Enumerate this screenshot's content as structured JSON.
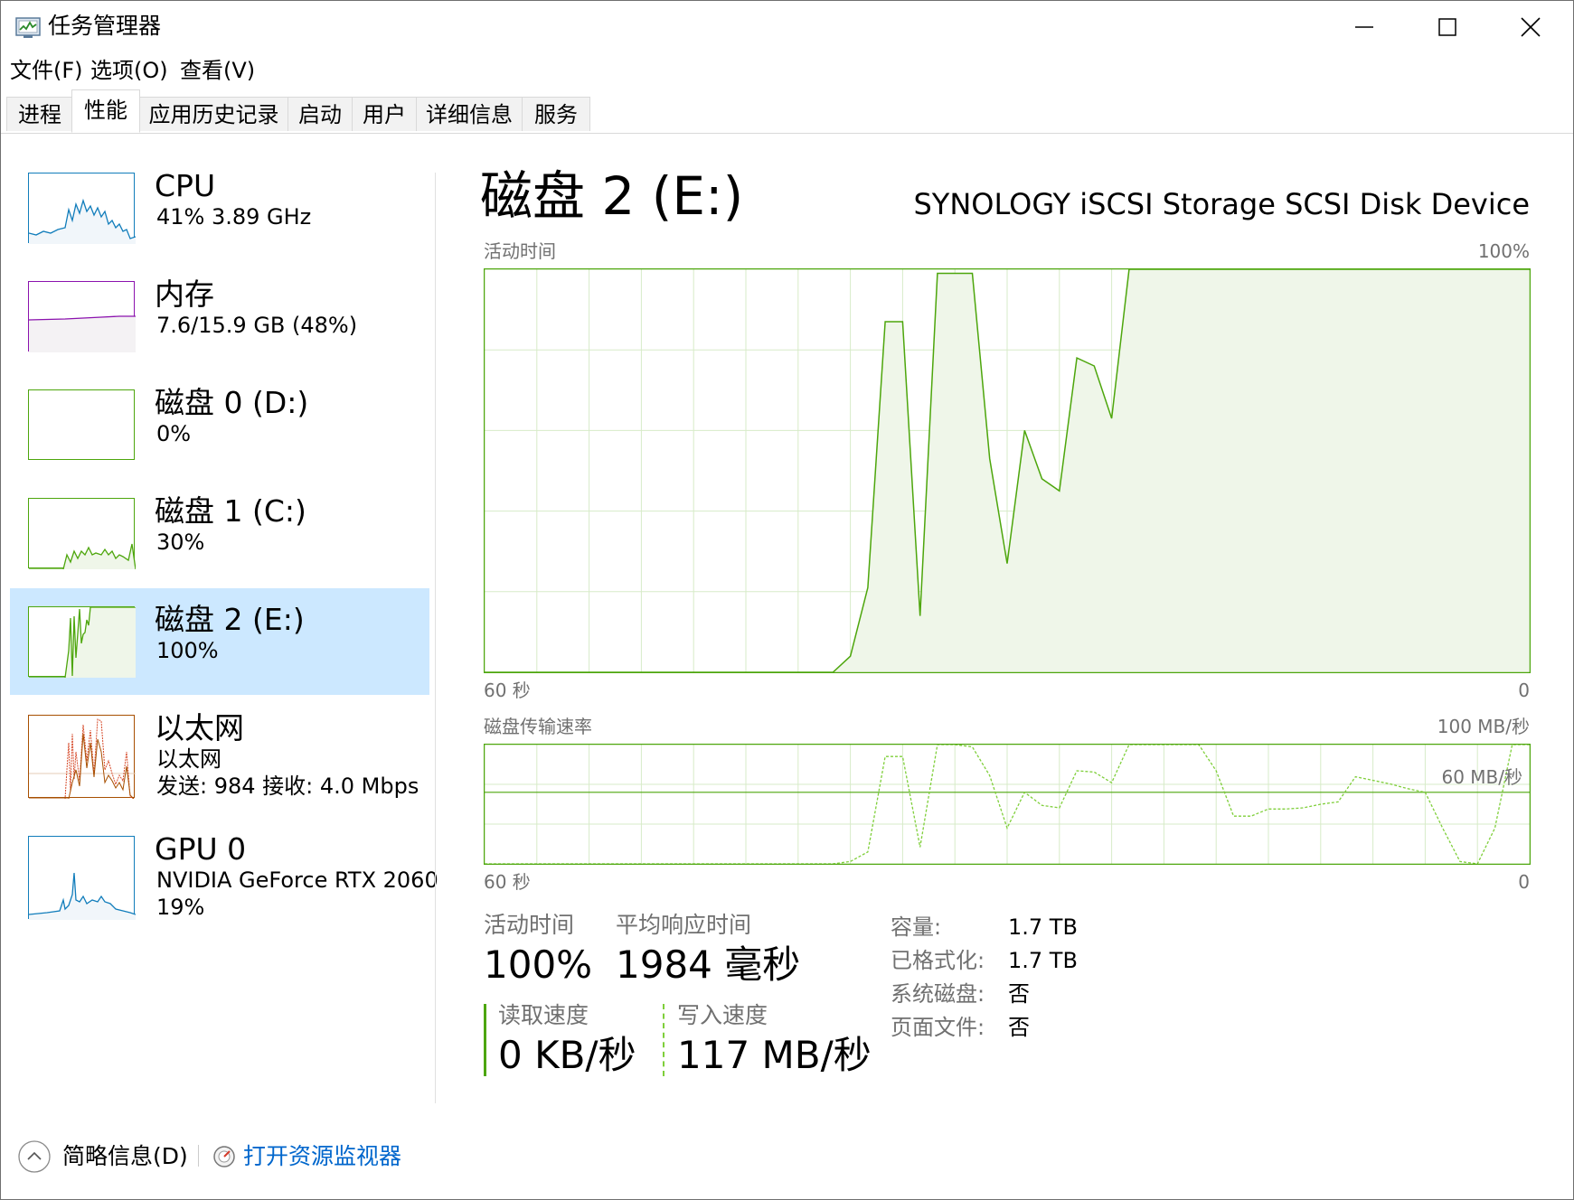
{
  "window": {
    "title": "任务管理器"
  },
  "menu": {
    "file": "文件(F)",
    "options": "选项(O)",
    "view": "查看(V)"
  },
  "tabs": [
    {
      "label": "进程"
    },
    {
      "label": "性能"
    },
    {
      "label": "应用历史记录"
    },
    {
      "label": "启动"
    },
    {
      "label": "用户"
    },
    {
      "label": "详细信息"
    },
    {
      "label": "服务"
    }
  ],
  "sidebar": {
    "cpu": {
      "title": "CPU",
      "sub": "41%  3.89 GHz"
    },
    "memory": {
      "title": "内存",
      "sub": "7.6/15.9 GB (48%)"
    },
    "disk0": {
      "title": "磁盘 0 (D:)",
      "sub": "0%"
    },
    "disk1": {
      "title": "磁盘 1 (C:)",
      "sub": "30%"
    },
    "disk2": {
      "title": "磁盘 2 (E:)",
      "sub": "100%"
    },
    "ethernet": {
      "title": "以太网",
      "sub1": "以太网",
      "sub2": "发送: 984  接收: 4.0 Mbps"
    },
    "gpu": {
      "title": "GPU 0",
      "sub1": "NVIDIA GeForce RTX 2060",
      "sub2": "19%"
    }
  },
  "colors": {
    "disk_line": "#4da60c",
    "disk_fill": "#eff6e9",
    "grid": "#d7ebc8",
    "cpu_line": "#117dbb",
    "memory_line": "#8b12ae",
    "ethernet_line": "#a74f01",
    "selected_bg": "#cce8ff",
    "link": "#0066cc"
  },
  "main": {
    "title": "磁盘 2 (E:)",
    "device": "SYNOLOGY iSCSI Storage SCSI Disk Device",
    "chart1": {
      "label": "活动时间",
      "max": "100%",
      "left_axis": "60 秒",
      "right_axis": "0"
    },
    "chart2": {
      "label": "磁盘传输速率",
      "max": "100 MB/秒",
      "mid": "60 MB/秒",
      "left_axis": "60 秒",
      "right_axis": "0"
    },
    "stats": {
      "active_label": "活动时间",
      "active_value": "100%",
      "response_label": "平均响应时间",
      "response_value": "1984 毫秒",
      "read_label": "读取速度",
      "read_value": "0 KB/秒",
      "write_label": "写入速度",
      "write_value": "117 MB/秒"
    },
    "props": {
      "capacity_label": "容量:",
      "capacity_value": "1.7 TB",
      "formatted_label": "已格式化:",
      "formatted_value": "1.7 TB",
      "system_label": "系统磁盘:",
      "system_value": "否",
      "pagefile_label": "页面文件:",
      "pagefile_value": "否"
    }
  },
  "footer": {
    "summary": "简略信息(D)",
    "resource_monitor": "打开资源监视器"
  },
  "chart_data": [
    {
      "type": "area",
      "title": "活动时间",
      "ylim": [
        0,
        100
      ],
      "xlim": [
        60,
        0
      ],
      "x": [
        60,
        59,
        58,
        57,
        56,
        55,
        54,
        53,
        52,
        51,
        50,
        49,
        48,
        47,
        46,
        45,
        44,
        43,
        42,
        41,
        40,
        39,
        38,
        37,
        36,
        35,
        34,
        33,
        32,
        31,
        30,
        29,
        28,
        27,
        26,
        25,
        24,
        23,
        22,
        21,
        20,
        19,
        18,
        17,
        16,
        15,
        14,
        13,
        12,
        11,
        10,
        9,
        8,
        7,
        6,
        5,
        4,
        3,
        2,
        1,
        0
      ],
      "series": [
        {
          "values": [
            0,
            0,
            0,
            0,
            0,
            0,
            0,
            0,
            0,
            0,
            0,
            0,
            0,
            0,
            0,
            0,
            0,
            0,
            0,
            0,
            0,
            4,
            21,
            87,
            87,
            14,
            99,
            99,
            99,
            53,
            27,
            60,
            48,
            45,
            78,
            76,
            63,
            100,
            100,
            100,
            100,
            100,
            100,
            100,
            100,
            100,
            100,
            100,
            100,
            100,
            100,
            100,
            100,
            100,
            100,
            100,
            100,
            100,
            100,
            100,
            100
          ]
        }
      ]
    },
    {
      "type": "line",
      "title": "磁盘传输速率",
      "ylim": [
        0,
        100
      ],
      "xlim": [
        60,
        0
      ],
      "x": [
        60,
        59,
        58,
        57,
        56,
        55,
        54,
        53,
        52,
        51,
        50,
        49,
        48,
        47,
        46,
        45,
        44,
        43,
        42,
        41,
        40,
        39,
        38,
        37,
        36,
        35,
        34,
        33,
        32,
        31,
        30,
        29,
        28,
        27,
        26,
        25,
        24,
        23,
        22,
        21,
        20,
        19,
        18,
        17,
        16,
        15,
        14,
        13,
        12,
        11,
        10,
        9,
        8,
        7,
        6,
        5,
        4,
        3,
        2,
        1,
        0
      ],
      "series": [
        {
          "values": [
            0,
            0,
            0,
            0,
            0,
            0,
            0,
            0,
            0,
            0,
            0,
            0,
            0,
            0,
            0,
            0,
            0,
            0,
            0,
            0,
            0,
            2,
            10,
            90,
            90,
            14,
            100,
            100,
            98,
            74,
            30,
            60,
            49,
            47,
            78,
            77,
            68,
            100,
            100,
            100,
            100,
            100,
            78,
            40,
            40,
            46,
            46,
            47,
            50,
            52,
            73,
            70,
            67,
            63,
            60,
            30,
            2,
            0,
            30,
            100,
            100
          ]
        }
      ]
    }
  ]
}
